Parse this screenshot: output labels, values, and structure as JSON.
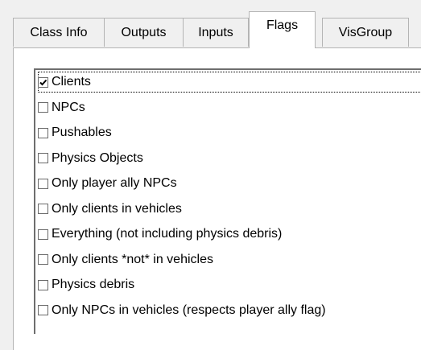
{
  "tabs": [
    {
      "label": "Class Info",
      "active": false
    },
    {
      "label": "Outputs",
      "active": false
    },
    {
      "label": "Inputs",
      "active": false
    },
    {
      "label": "Flags",
      "active": true
    },
    {
      "label": "VisGroup",
      "active": false
    }
  ],
  "flags": [
    {
      "label": "Clients",
      "checked": true,
      "focused": true
    },
    {
      "label": "NPCs",
      "checked": false
    },
    {
      "label": "Pushables",
      "checked": false
    },
    {
      "label": "Physics Objects",
      "checked": false
    },
    {
      "label": "Only player ally NPCs",
      "checked": false
    },
    {
      "label": "Only clients in vehicles",
      "checked": false
    },
    {
      "label": "Everything (not including physics debris)",
      "checked": false
    },
    {
      "label": "Only clients *not* in vehicles",
      "checked": false
    },
    {
      "label": "Physics debris",
      "checked": false
    },
    {
      "label": "Only NPCs in vehicles (respects player ally flag)",
      "checked": false
    }
  ]
}
